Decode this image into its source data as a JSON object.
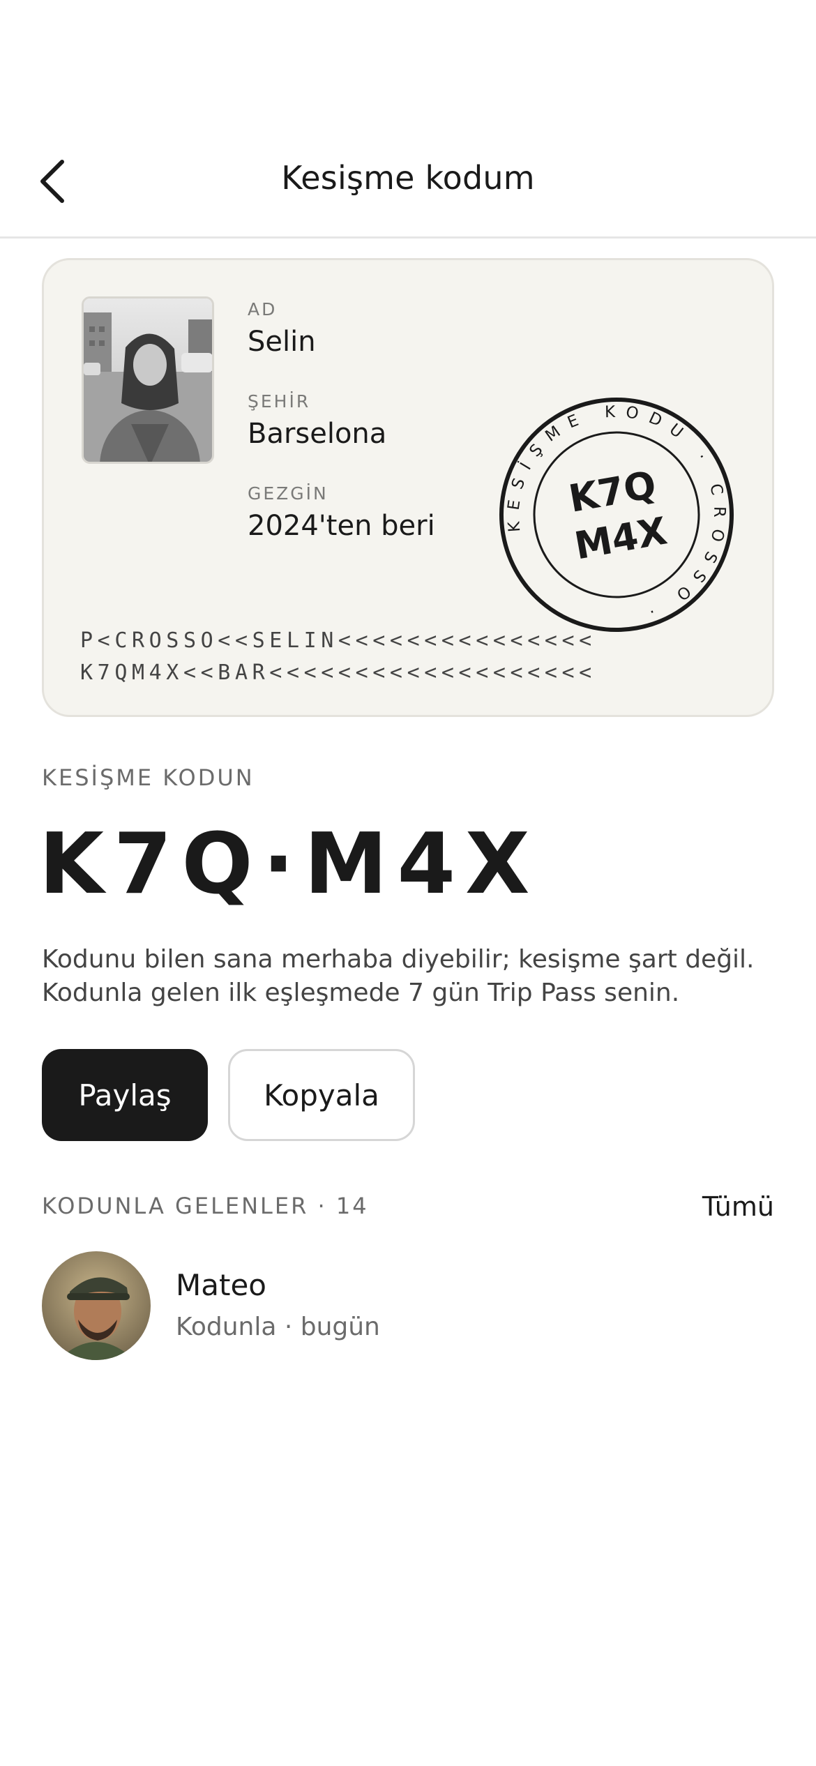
{
  "header": {
    "title": "Kesişme kodum",
    "back_icon": "chevron-left-icon"
  },
  "pass": {
    "name_label": "AD",
    "name_value": "Selin",
    "city_label": "ŞEHİR",
    "city_value": "Barselona",
    "traveler_label": "GEZGİN",
    "traveler_value": "2024'ten beri",
    "stamp": {
      "ring_text": "KESİŞME KODU · CROSSO ·",
      "code_line1": "K7Q",
      "code_line2": "M4X"
    },
    "mrz_line1": "P<CROSSO<<SELIN<<<<<<<<<<<<<<<",
    "mrz_line2": "K7QM4X<<BAR<<<<<<<<<<<<<<<<<<<"
  },
  "code_section": {
    "label": "KESİŞME KODUN",
    "code": "K7Q·M4X",
    "description_line1": "Kodunu bilen sana merhaba diyebilir; kesişme şart değil.",
    "description_line2": "Kodunla gelen ilk eşleşmede 7 gün Trip Pass senin."
  },
  "actions": {
    "share_label": "Paylaş",
    "copy_label": "Kopyala"
  },
  "referrals": {
    "label": "KODUNLA GELENLER · 14",
    "see_all_label": "Tümü",
    "items": [
      {
        "name": "Mateo",
        "subtitle": "Kodunla · bugün"
      }
    ]
  }
}
